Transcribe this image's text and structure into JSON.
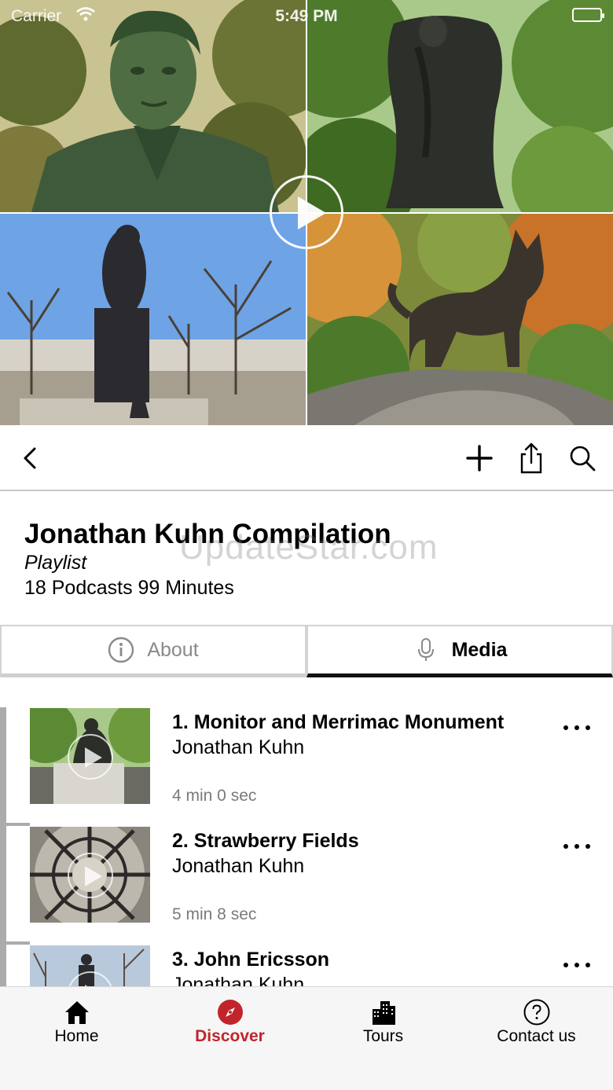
{
  "status_bar": {
    "carrier": "Carrier",
    "time": "5:49 PM"
  },
  "playlist": {
    "title": "Jonathan Kuhn Compilation",
    "type": "Playlist",
    "meta": "18 Podcasts 99 Minutes"
  },
  "watermark": "UpdateStar.com",
  "tabs": [
    {
      "label": "About",
      "icon": "info-icon",
      "selected": false
    },
    {
      "label": "Media",
      "icon": "microphone-icon",
      "selected": true
    }
  ],
  "media": [
    {
      "title": "1. Monitor and Merrimac Monument",
      "author": "Jonathan Kuhn",
      "duration": "4 min 0 sec"
    },
    {
      "title": "2. Strawberry Fields",
      "author": "Jonathan Kuhn",
      "duration": "5 min 8 sec"
    },
    {
      "title": "3. John Ericsson",
      "author": "Jonathan Kuhn",
      "duration": ""
    }
  ],
  "nav": [
    {
      "label": "Home",
      "icon": "home-icon"
    },
    {
      "label": "Discover",
      "icon": "compass-icon",
      "active": true
    },
    {
      "label": "Tours",
      "icon": "buildings-icon"
    },
    {
      "label": "Contact us",
      "icon": "help-icon"
    }
  ],
  "colors": {
    "accent": "#c2242b",
    "divider": "#ababab",
    "tab_underline": "#111111"
  }
}
